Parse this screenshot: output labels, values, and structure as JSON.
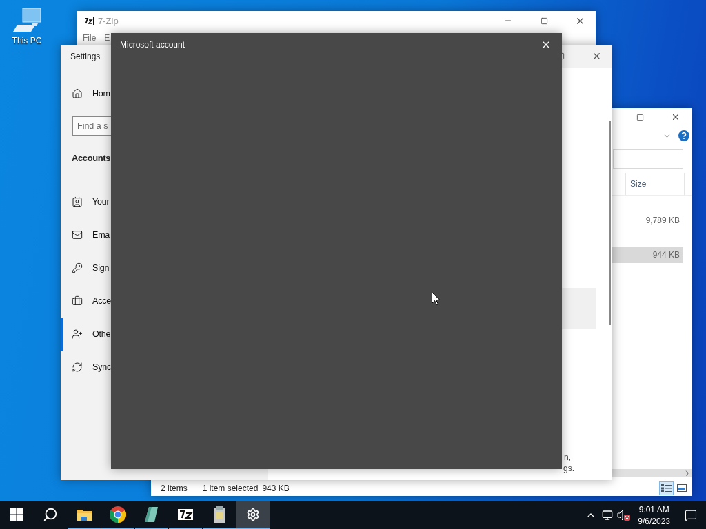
{
  "desktop": {
    "icons": [
      {
        "label": "This PC"
      }
    ]
  },
  "explorer": {
    "column": "Size",
    "rows": [
      {
        "size": "9,789 KB",
        "selected": false
      },
      {
        "size": "944 KB",
        "selected": true
      }
    ],
    "status": [
      "2 items",
      "1 item selected",
      "943 KB"
    ],
    "views": [
      {
        "kind": "details",
        "selected": true
      },
      {
        "kind": "preview",
        "selected": false
      }
    ]
  },
  "zip": {
    "title": "7-Zip",
    "menu": [
      "File",
      "E"
    ]
  },
  "settings": {
    "title": "Settings",
    "home": "Hom",
    "search": {
      "placeholder": "Find a s"
    },
    "section": "Accounts",
    "nav": [
      {
        "label": "Your",
        "kind": "info",
        "selected": false
      },
      {
        "label": "Ema",
        "kind": "mail",
        "selected": false
      },
      {
        "label": "Sign",
        "kind": "key",
        "selected": false
      },
      {
        "label": "Acce",
        "kind": "work",
        "selected": false
      },
      {
        "label": "Othe",
        "kind": "people",
        "selected": true
      },
      {
        "label": "Sync",
        "kind": "sync",
        "selected": false
      }
    ],
    "footer": [
      "n,",
      "gs."
    ]
  },
  "dialog": {
    "title": "Microsoft account"
  },
  "taskbar": {
    "apps": [
      {
        "kind": "folder",
        "running": true,
        "selected": false
      },
      {
        "kind": "browser",
        "running": true,
        "selected": false
      },
      {
        "kind": "notes",
        "running": true,
        "selected": false
      },
      {
        "kind": "archive",
        "running": true,
        "selected": false
      },
      {
        "kind": "installer",
        "running": true,
        "selected": false
      },
      {
        "kind": "settings",
        "running": true,
        "selected": true
      }
    ],
    "time": "9:01 AM",
    "date": "9/6/2023"
  }
}
